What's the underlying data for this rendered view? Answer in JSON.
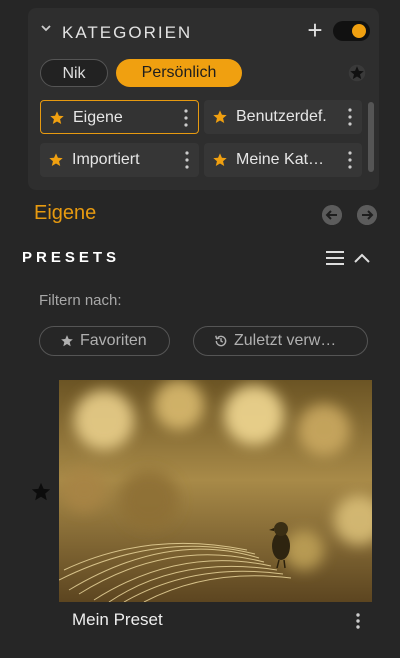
{
  "categories": {
    "title": "KATEGORIEN",
    "add_label": "+",
    "tabs": [
      "Nik",
      "Persönlich"
    ],
    "active_tab": "Persönlich",
    "items": [
      {
        "label": "Eigene",
        "selected": true
      },
      {
        "label": "Benutzerdef."
      },
      {
        "label": "Importiert"
      },
      {
        "label": "Meine Kat…"
      }
    ]
  },
  "current_category": "Eigene",
  "presets": {
    "title": "PRESETS",
    "filter_label": "Filtern nach:",
    "filters": [
      {
        "label": "Favoriten",
        "icon": "star-icon"
      },
      {
        "label": "Zuletzt verw…",
        "icon": "history-icon"
      }
    ],
    "items": [
      {
        "name": "Mein Preset"
      }
    ]
  },
  "colors": {
    "accent": "#f0a010",
    "background": "#262626",
    "panel": "#2e2e2e"
  }
}
